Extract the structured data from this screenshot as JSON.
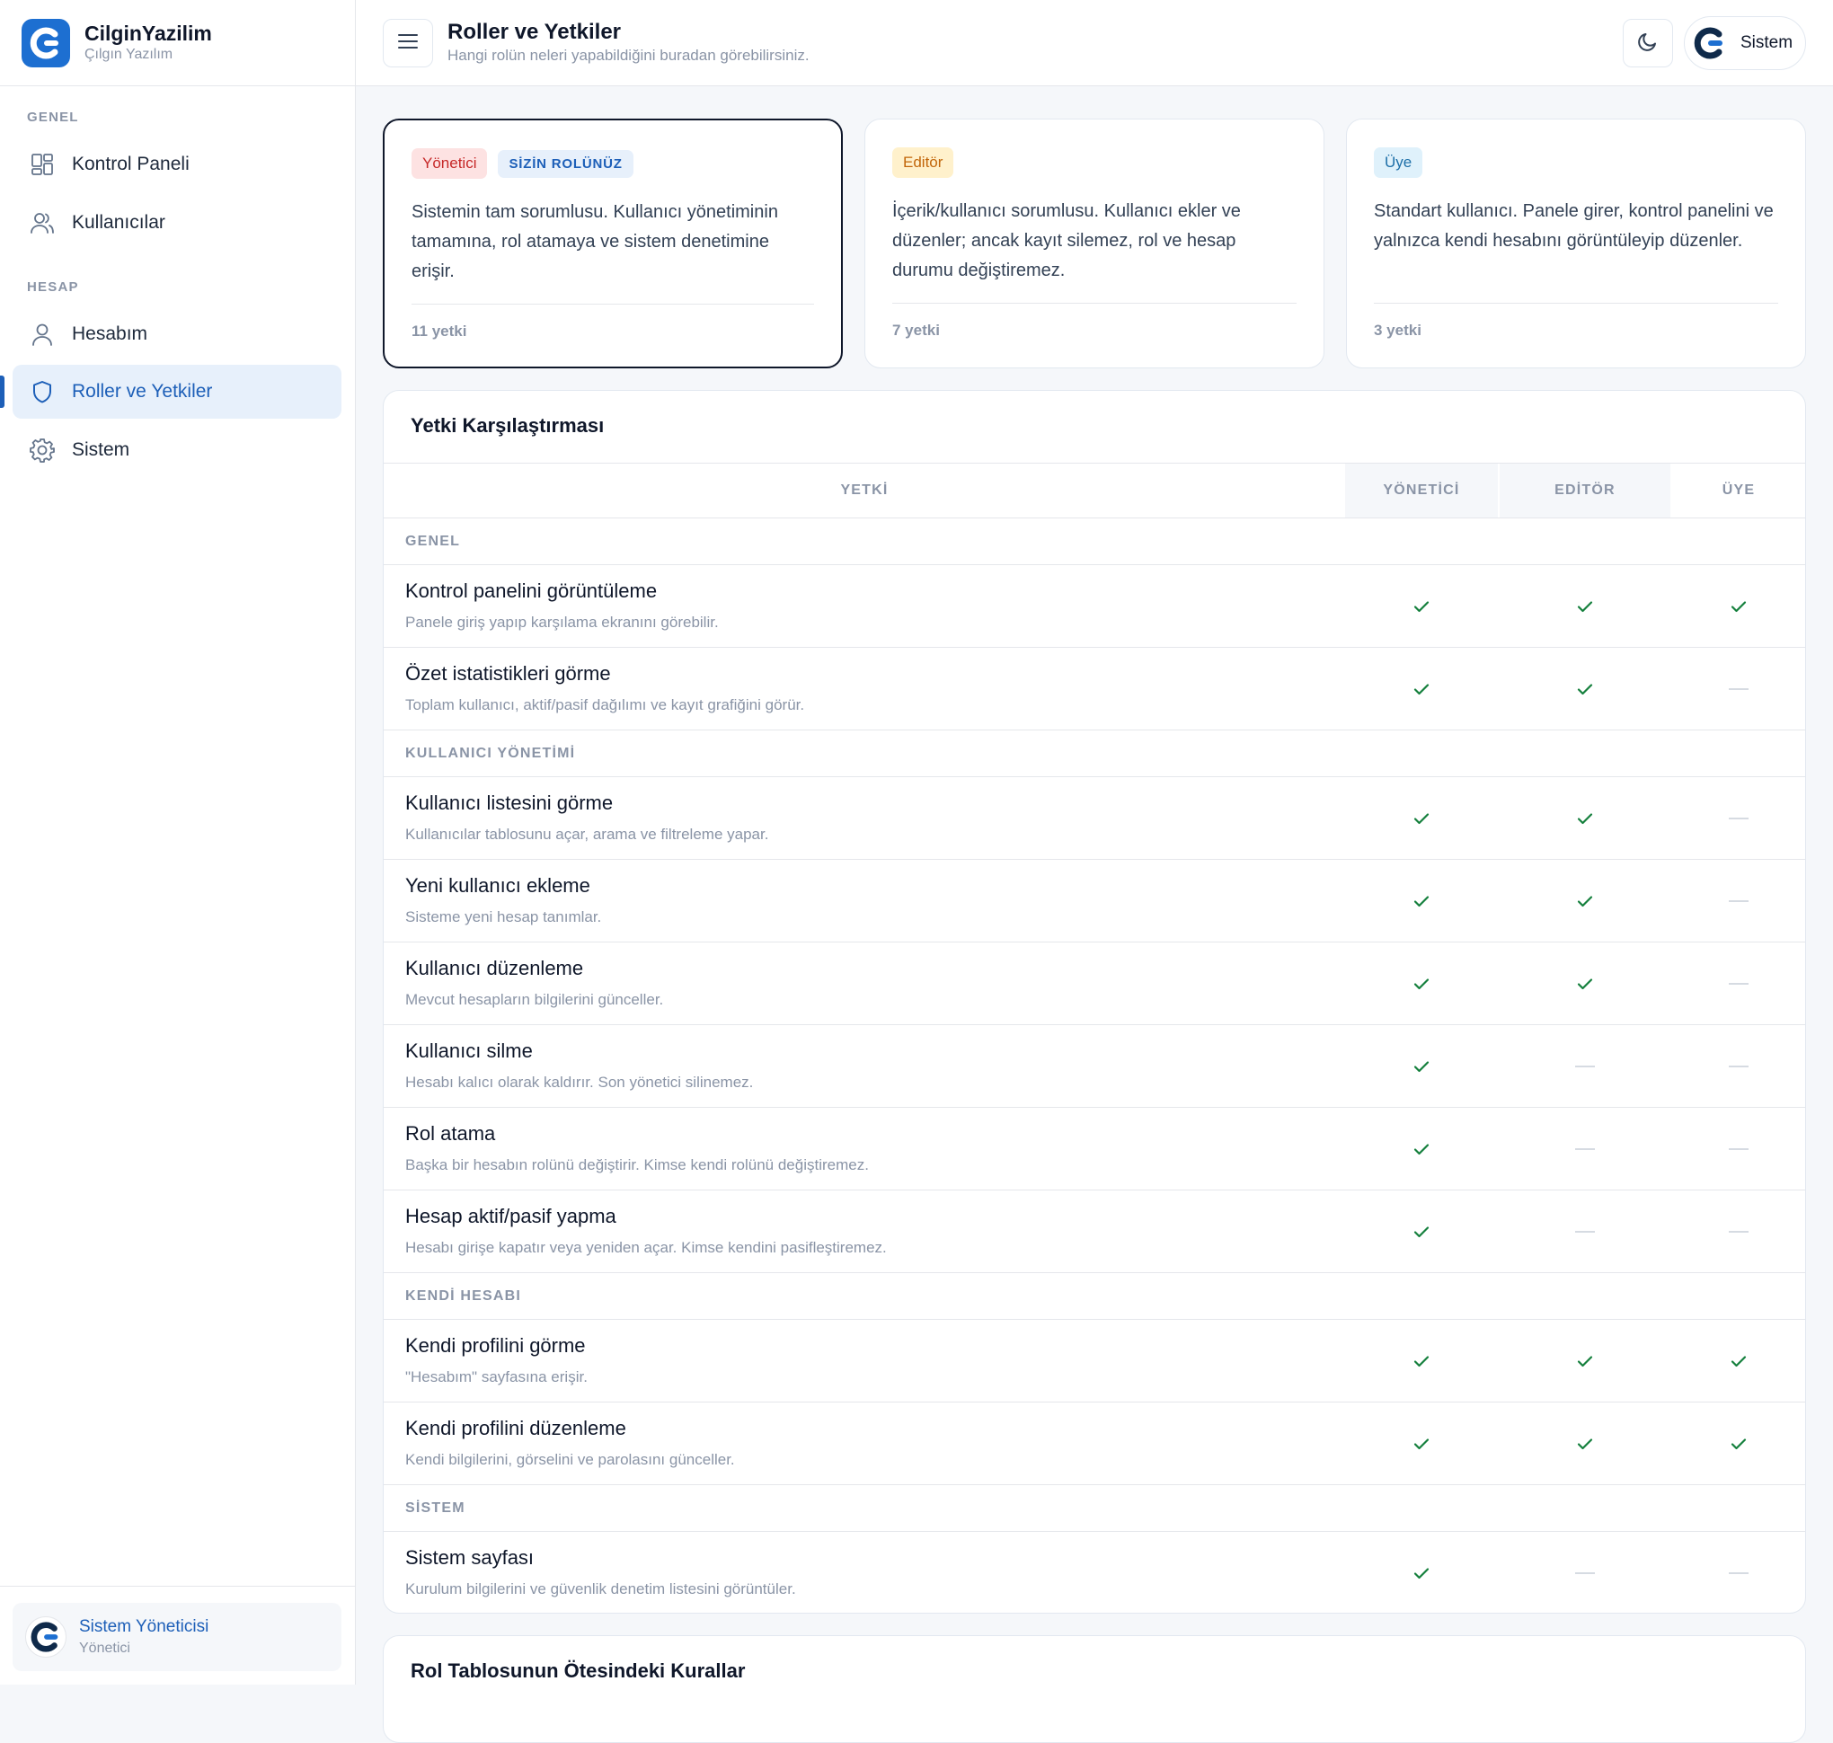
{
  "brand": {
    "name": "CilginYazilim",
    "subtitle": "Çılgın Yazılım"
  },
  "nav": {
    "sections": [
      {
        "title": "GENEL",
        "items": [
          {
            "label": "Kontrol Paneli",
            "icon": "dashboard-icon"
          },
          {
            "label": "Kullanıcılar",
            "icon": "users-icon"
          }
        ]
      },
      {
        "title": "HESAP",
        "items": [
          {
            "label": "Hesabım",
            "icon": "user-icon"
          },
          {
            "label": "Roller ve Yetkiler",
            "icon": "shield-icon",
            "active": true
          },
          {
            "label": "Sistem",
            "icon": "gear-icon"
          }
        ]
      }
    ]
  },
  "current_user": {
    "name": "Sistem Yöneticisi",
    "role": "Yönetici"
  },
  "header": {
    "title": "Roller ve Yetkiler",
    "subtitle": "Hangi rolün neleri yapabildiğini buradan görebilirsiniz.",
    "profile_label": "Sistem"
  },
  "roles": [
    {
      "name": "Yönetici",
      "mine_badge": "SİZİN ROLÜNÜZ",
      "description": "Sistemin tam sorumlusu. Kullanıcı yönetiminin tamamına, rol atamaya ve sistem denetimine erişir.",
      "count": "11 yetki"
    },
    {
      "name": "Editör",
      "description": "İçerik/kullanıcı sorumlusu. Kullanıcı ekler ve düzenler; ancak kayıt silemez, rol ve hesap durumu değiştiremez.",
      "count": "7 yetki"
    },
    {
      "name": "Üye",
      "description": "Standart kullanıcı. Panele girer, kontrol panelini ve yalnızca kendi hesabını görüntüleyip düzenler.",
      "count": "3 yetki"
    }
  ],
  "comparison": {
    "title": "Yetki Karşılaştırması",
    "columns": {
      "permission": "YETKİ",
      "admin": "YÖNETİCİ",
      "editor": "EDİTÖR",
      "member": "ÜYE"
    },
    "groups": [
      {
        "title": "GENEL",
        "rows": [
          {
            "name": "Kontrol panelini görüntüleme",
            "desc": "Panele giriş yapıp karşılama ekranını görebilir.",
            "admin": true,
            "editor": true,
            "member": true
          },
          {
            "name": "Özet istatistikleri görme",
            "desc": "Toplam kullanıcı, aktif/pasif dağılımı ve kayıt grafiğini görür.",
            "admin": true,
            "editor": true,
            "member": false
          }
        ]
      },
      {
        "title": "KULLANICI YÖNETİMİ",
        "rows": [
          {
            "name": "Kullanıcı listesini görme",
            "desc": "Kullanıcılar tablosunu açar, arama ve filtreleme yapar.",
            "admin": true,
            "editor": true,
            "member": false
          },
          {
            "name": "Yeni kullanıcı ekleme",
            "desc": "Sisteme yeni hesap tanımlar.",
            "admin": true,
            "editor": true,
            "member": false
          },
          {
            "name": "Kullanıcı düzenleme",
            "desc": "Mevcut hesapların bilgilerini günceller.",
            "admin": true,
            "editor": true,
            "member": false
          },
          {
            "name": "Kullanıcı silme",
            "desc": "Hesabı kalıcı olarak kaldırır. Son yönetici silinemez.",
            "admin": true,
            "editor": false,
            "member": false
          },
          {
            "name": "Rol atama",
            "desc": "Başka bir hesabın rolünü değiştirir. Kimse kendi rolünü değiştiremez.",
            "admin": true,
            "editor": false,
            "member": false
          },
          {
            "name": "Hesap aktif/pasif yapma",
            "desc": "Hesabı girişe kapatır veya yeniden açar. Kimse kendini pasifleştiremez.",
            "admin": true,
            "editor": false,
            "member": false
          }
        ]
      },
      {
        "title": "KENDİ HESABI",
        "rows": [
          {
            "name": "Kendi profilini görme",
            "desc": "\"Hesabım\" sayfasına erişir.",
            "admin": true,
            "editor": true,
            "member": true
          },
          {
            "name": "Kendi profilini düzenleme",
            "desc": "Kendi bilgilerini, görselini ve parolasını günceller.",
            "admin": true,
            "editor": true,
            "member": true
          }
        ]
      },
      {
        "title": "SİSTEM",
        "rows": [
          {
            "name": "Sistem sayfası",
            "desc": "Kurulum bilgilerini ve güvenlik denetim listesini görüntüler.",
            "admin": true,
            "editor": false,
            "member": false
          }
        ]
      }
    ]
  },
  "rules_panel": {
    "title": "Rol Tablosunun Ötesindeki Kurallar"
  },
  "colors": {
    "accent": "#1d5fb8",
    "check": "#15803d",
    "admin_badge": "#c62828",
    "editor_badge": "#c2660a",
    "member_badge": "#1d6fa8"
  }
}
